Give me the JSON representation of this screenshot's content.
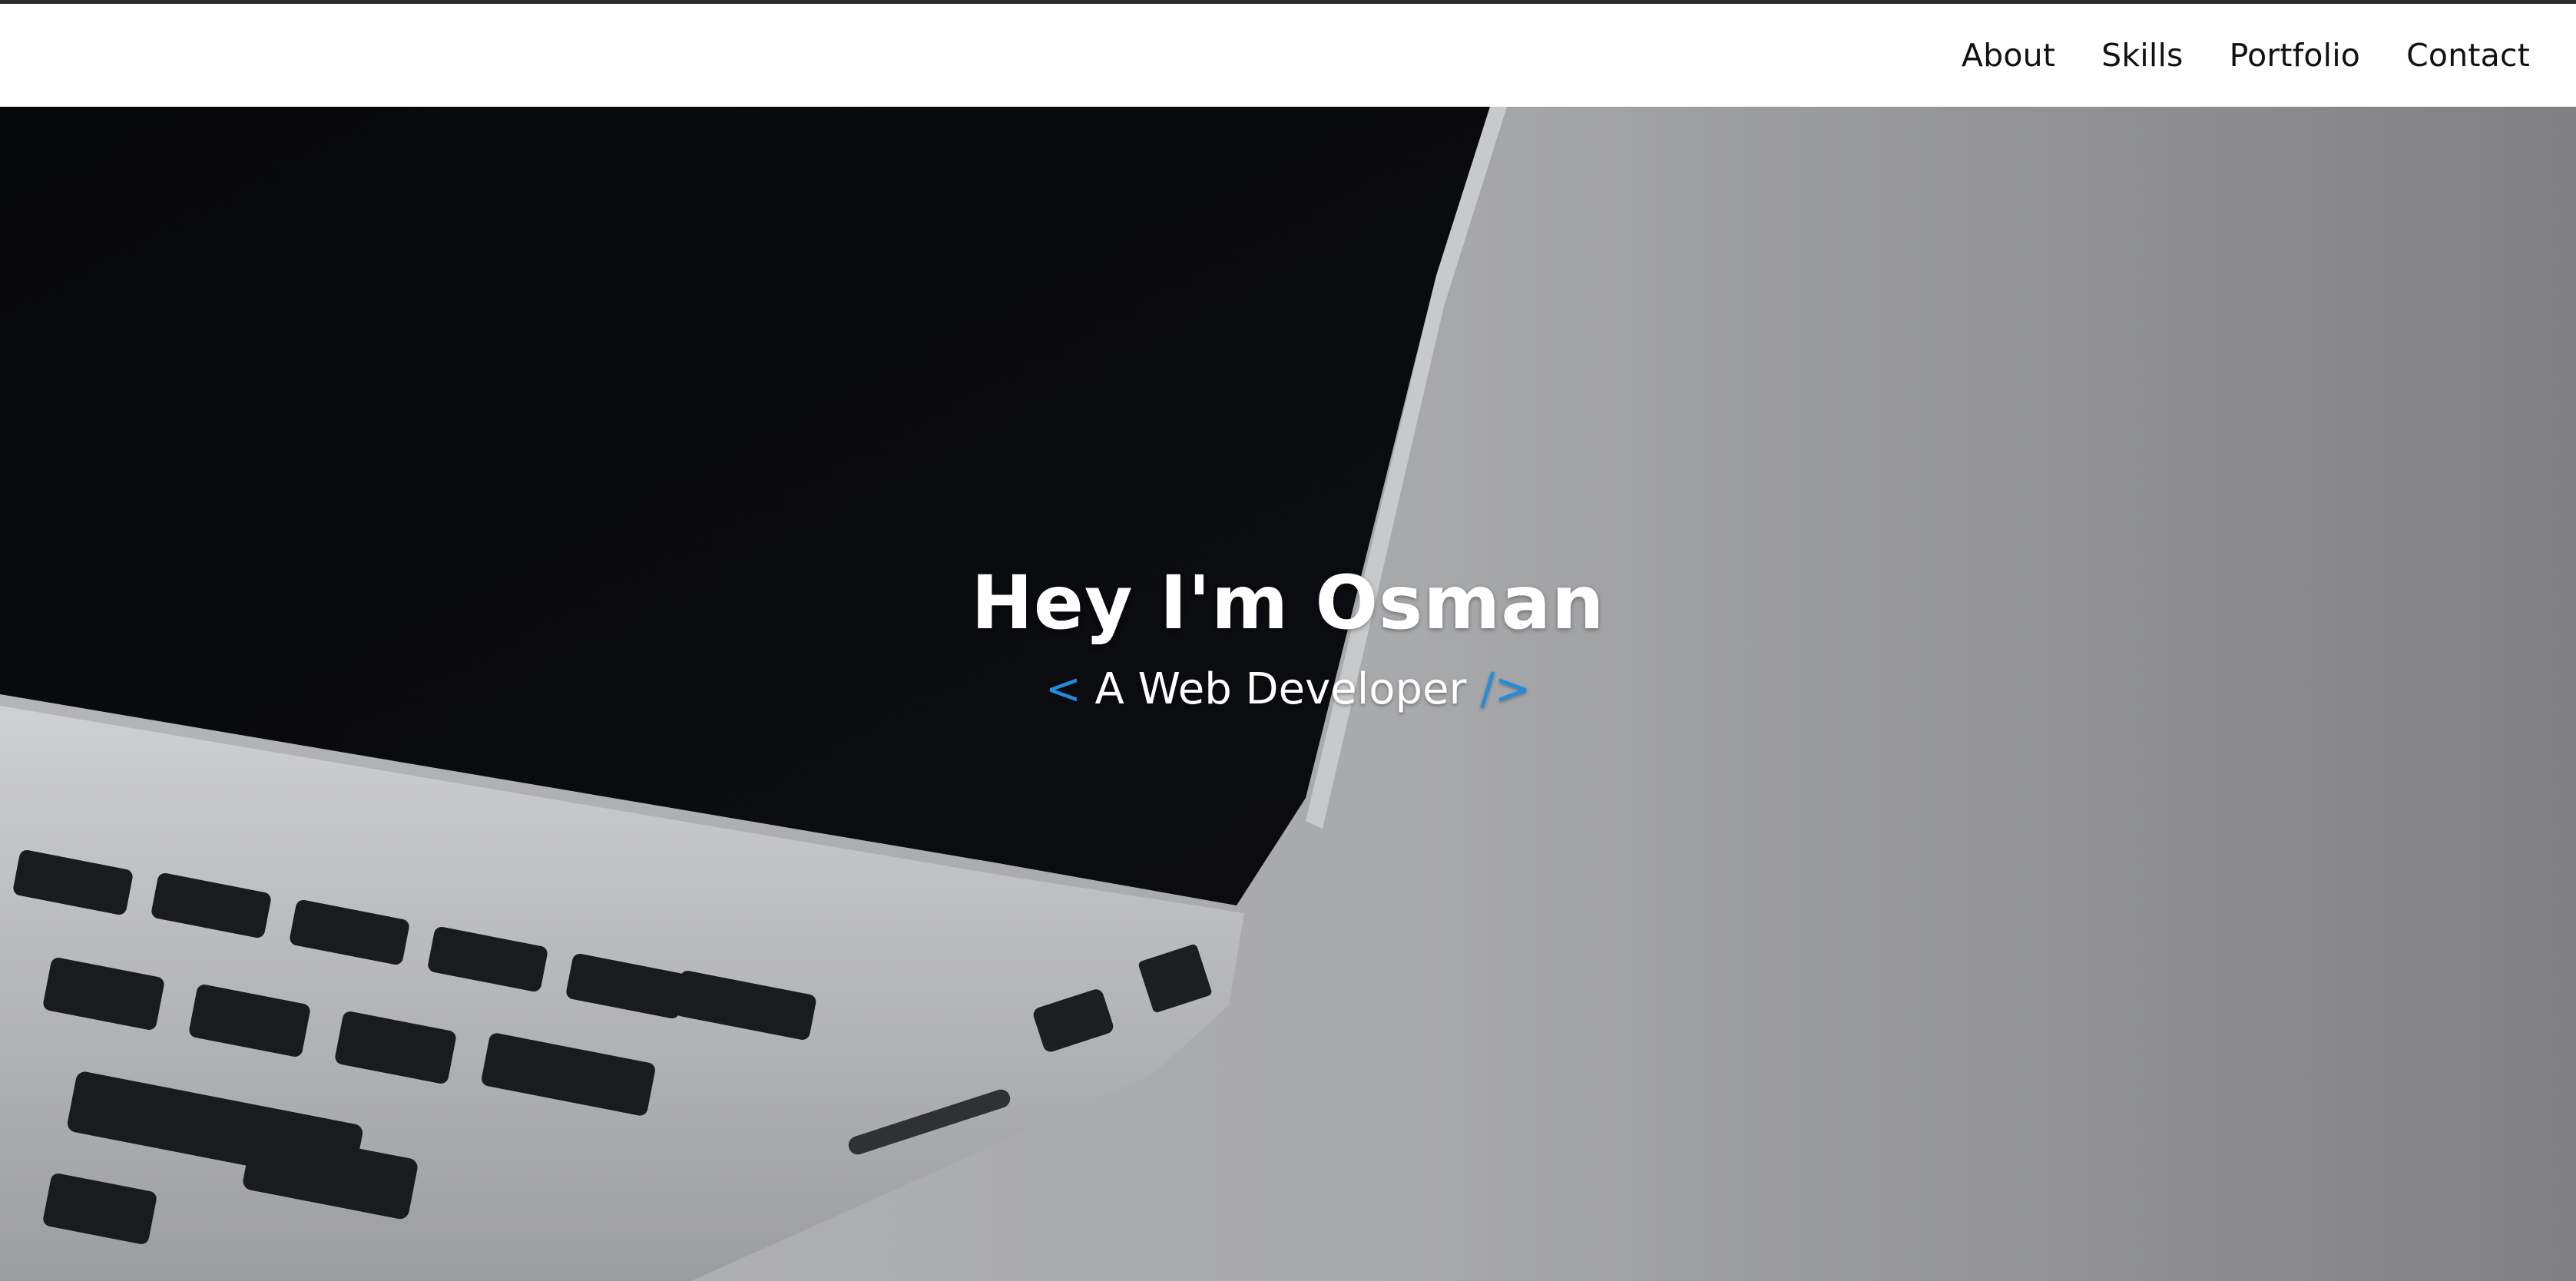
{
  "nav": {
    "items": [
      {
        "label": "About"
      },
      {
        "label": "Skills"
      },
      {
        "label": "Portfolio"
      },
      {
        "label": "Contact"
      }
    ]
  },
  "hero": {
    "title": "Hey I'm Osman",
    "subtitle_open": "<",
    "subtitle_text": "A Web Developer",
    "subtitle_close": "/>",
    "background": "laptop-photo"
  },
  "colors": {
    "accent": "#1e8fe0",
    "nav_text": "#111111",
    "hero_text": "#ffffff"
  }
}
